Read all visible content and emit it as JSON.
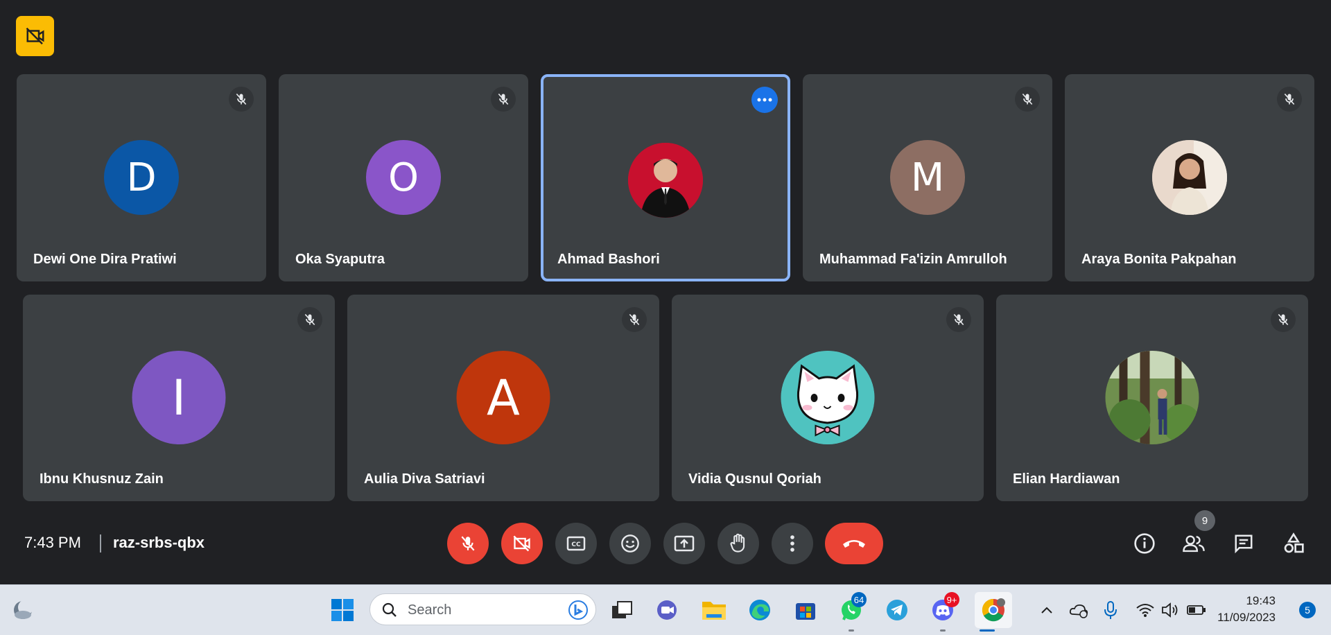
{
  "participants_row1": [
    {
      "name": "Dewi One Dira Pratiwi",
      "initial": "D",
      "color": "#0b57a6"
    },
    {
      "name": "Oka Syaputra",
      "initial": "O",
      "color": "#8a55c9"
    },
    {
      "name": "Ahmad Bashori",
      "initial": "",
      "color": "#c8102e"
    },
    {
      "name": "Muhammad Fa'izin Amrulloh",
      "initial": "M",
      "color": "#8d6e63"
    },
    {
      "name": "Araya Bonita Pakpahan",
      "initial": "",
      "color": "#d7c3b4"
    }
  ],
  "participants_row2": [
    {
      "name": "Ibnu Khusnuz Zain",
      "initial": "I",
      "color": "#7e57c2"
    },
    {
      "name": "Aulia Diva Satriavi",
      "initial": "A",
      "color": "#bf360c"
    },
    {
      "name": "Vidia Qusnul Qoriah",
      "initial": "",
      "color": "#4fc3c0"
    },
    {
      "name": "Elian Hardiawan",
      "initial": "",
      "color": "#4a6b3a"
    }
  ],
  "meeting": {
    "time": "7:43 PM",
    "code": "raz-srbs-qbx",
    "people_count": "9"
  },
  "taskbar": {
    "search_placeholder": "Search",
    "whatsapp_badge": "64",
    "discord_badge": "9+",
    "clock_time": "19:43",
    "clock_date": "11/09/2023",
    "notification_count": "5"
  },
  "colors": {
    "background": "#202124",
    "tile": "#3c4043",
    "active_border": "#8ab4f8",
    "danger": "#ea4335",
    "accent": "#1a73e8"
  }
}
